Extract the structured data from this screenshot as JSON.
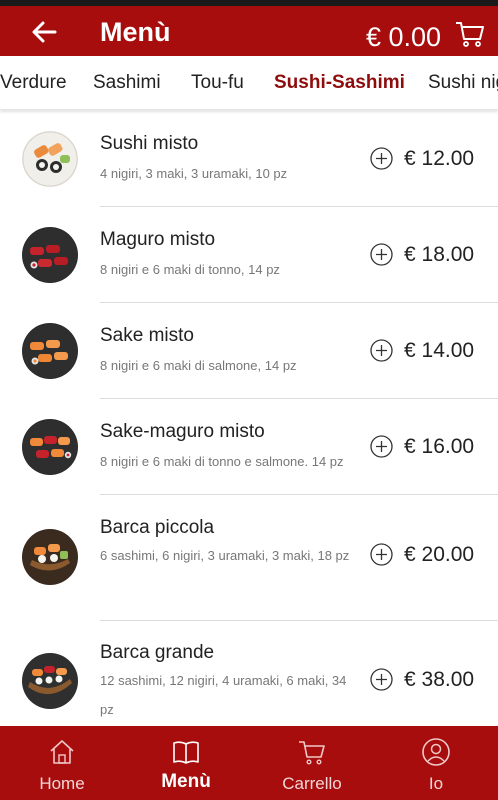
{
  "header": {
    "title": "Menù",
    "cart_total": "€ 0.00"
  },
  "tabs": [
    {
      "label": "Verdure"
    },
    {
      "label": "Sashimi"
    },
    {
      "label": "Tou-fu"
    },
    {
      "label": "Sushi-Sashimi",
      "active": true
    },
    {
      "label": "Sushi nig"
    }
  ],
  "items": [
    {
      "name": "Sushi misto",
      "desc": "4 nigiri, 3 maki, 3 uramaki, 10 pz",
      "price": "€ 12.00"
    },
    {
      "name": "Maguro misto",
      "desc": "8 nigiri e 6 maki di tonno, 14 pz",
      "price": "€ 18.00"
    },
    {
      "name": "Sake misto",
      "desc": "8 nigiri e 6 maki di salmone, 14 pz",
      "price": "€ 14.00"
    },
    {
      "name": "Sake-maguro misto",
      "desc": "8 nigiri e 6 maki di tonno e salmone. 14 pz",
      "price": "€ 16.00"
    },
    {
      "name": "Barca piccola",
      "desc": "6 sashimi, 6 nigiri, 3 uramaki, 3 maki, 18 pz",
      "price": "€ 20.00"
    },
    {
      "name": "Barca grande",
      "desc": "12 sashimi, 12 nigiri, 4 uramaki, 6 maki, 34 pz",
      "price": "€ 38.00"
    }
  ],
  "bottom_nav": [
    {
      "label": "Home",
      "icon": "home-icon"
    },
    {
      "label": "Menù",
      "icon": "book-icon",
      "active": true
    },
    {
      "label": "Carrello",
      "icon": "cart-icon"
    },
    {
      "label": "Io",
      "icon": "user-icon"
    }
  ],
  "colors": {
    "brand_red": "#a80d0d",
    "active_tab": "#8e0c0c"
  }
}
